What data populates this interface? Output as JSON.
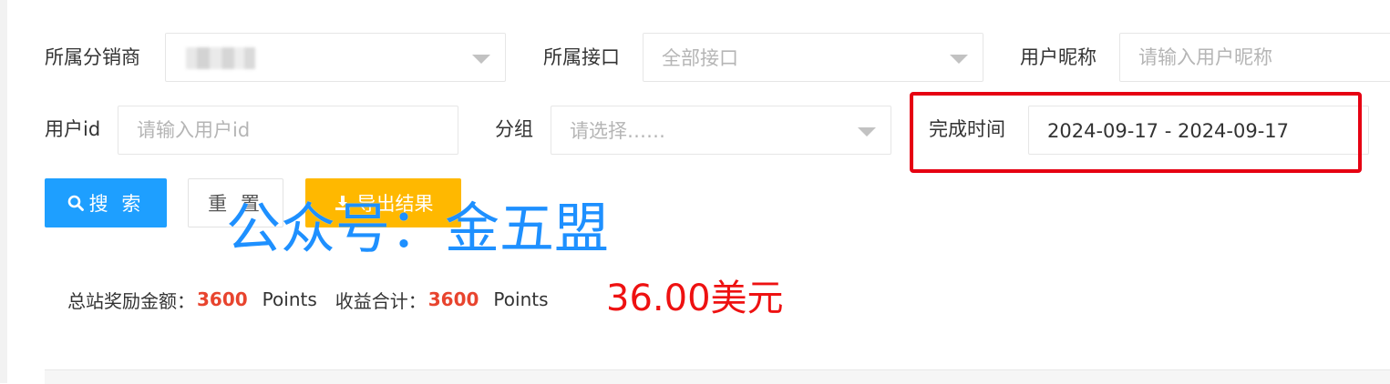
{
  "filters": {
    "distributor": {
      "label": "所属分销商",
      "value": ""
    },
    "interface": {
      "label": "所属接口",
      "value": "全部接口"
    },
    "nickname": {
      "label": "用户昵称",
      "placeholder": "请输入用户昵称"
    },
    "user_id": {
      "label": "用户id",
      "placeholder": "请输入用户id"
    },
    "group": {
      "label": "分组",
      "value": "请选择……"
    },
    "completed_time": {
      "label": "完成时间",
      "value": "2024-09-17 - 2024-09-17"
    }
  },
  "actions": {
    "search_label": "搜 索",
    "reset_label": "重 置",
    "export_label": "导出结果"
  },
  "watermark": {
    "text": "公众号：金五盟"
  },
  "stats": {
    "total_reward_label": "总站奖励金额：",
    "total_reward_value": "3600",
    "total_reward_unit": "Points",
    "income_label": "收益合计：",
    "income_value": "3600",
    "income_unit": "Points",
    "usd_amount": "36.00美元"
  },
  "colors": {
    "primary": "#1e9fff",
    "warning": "#ffb800",
    "highlight_border": "#e60012",
    "stat_value": "#e8442e",
    "usd": "#ee1111",
    "watermark": "#1e90ff"
  },
  "icons": {
    "search": "search-icon",
    "export": "download-icon",
    "dropdown": "caret-down-icon"
  }
}
